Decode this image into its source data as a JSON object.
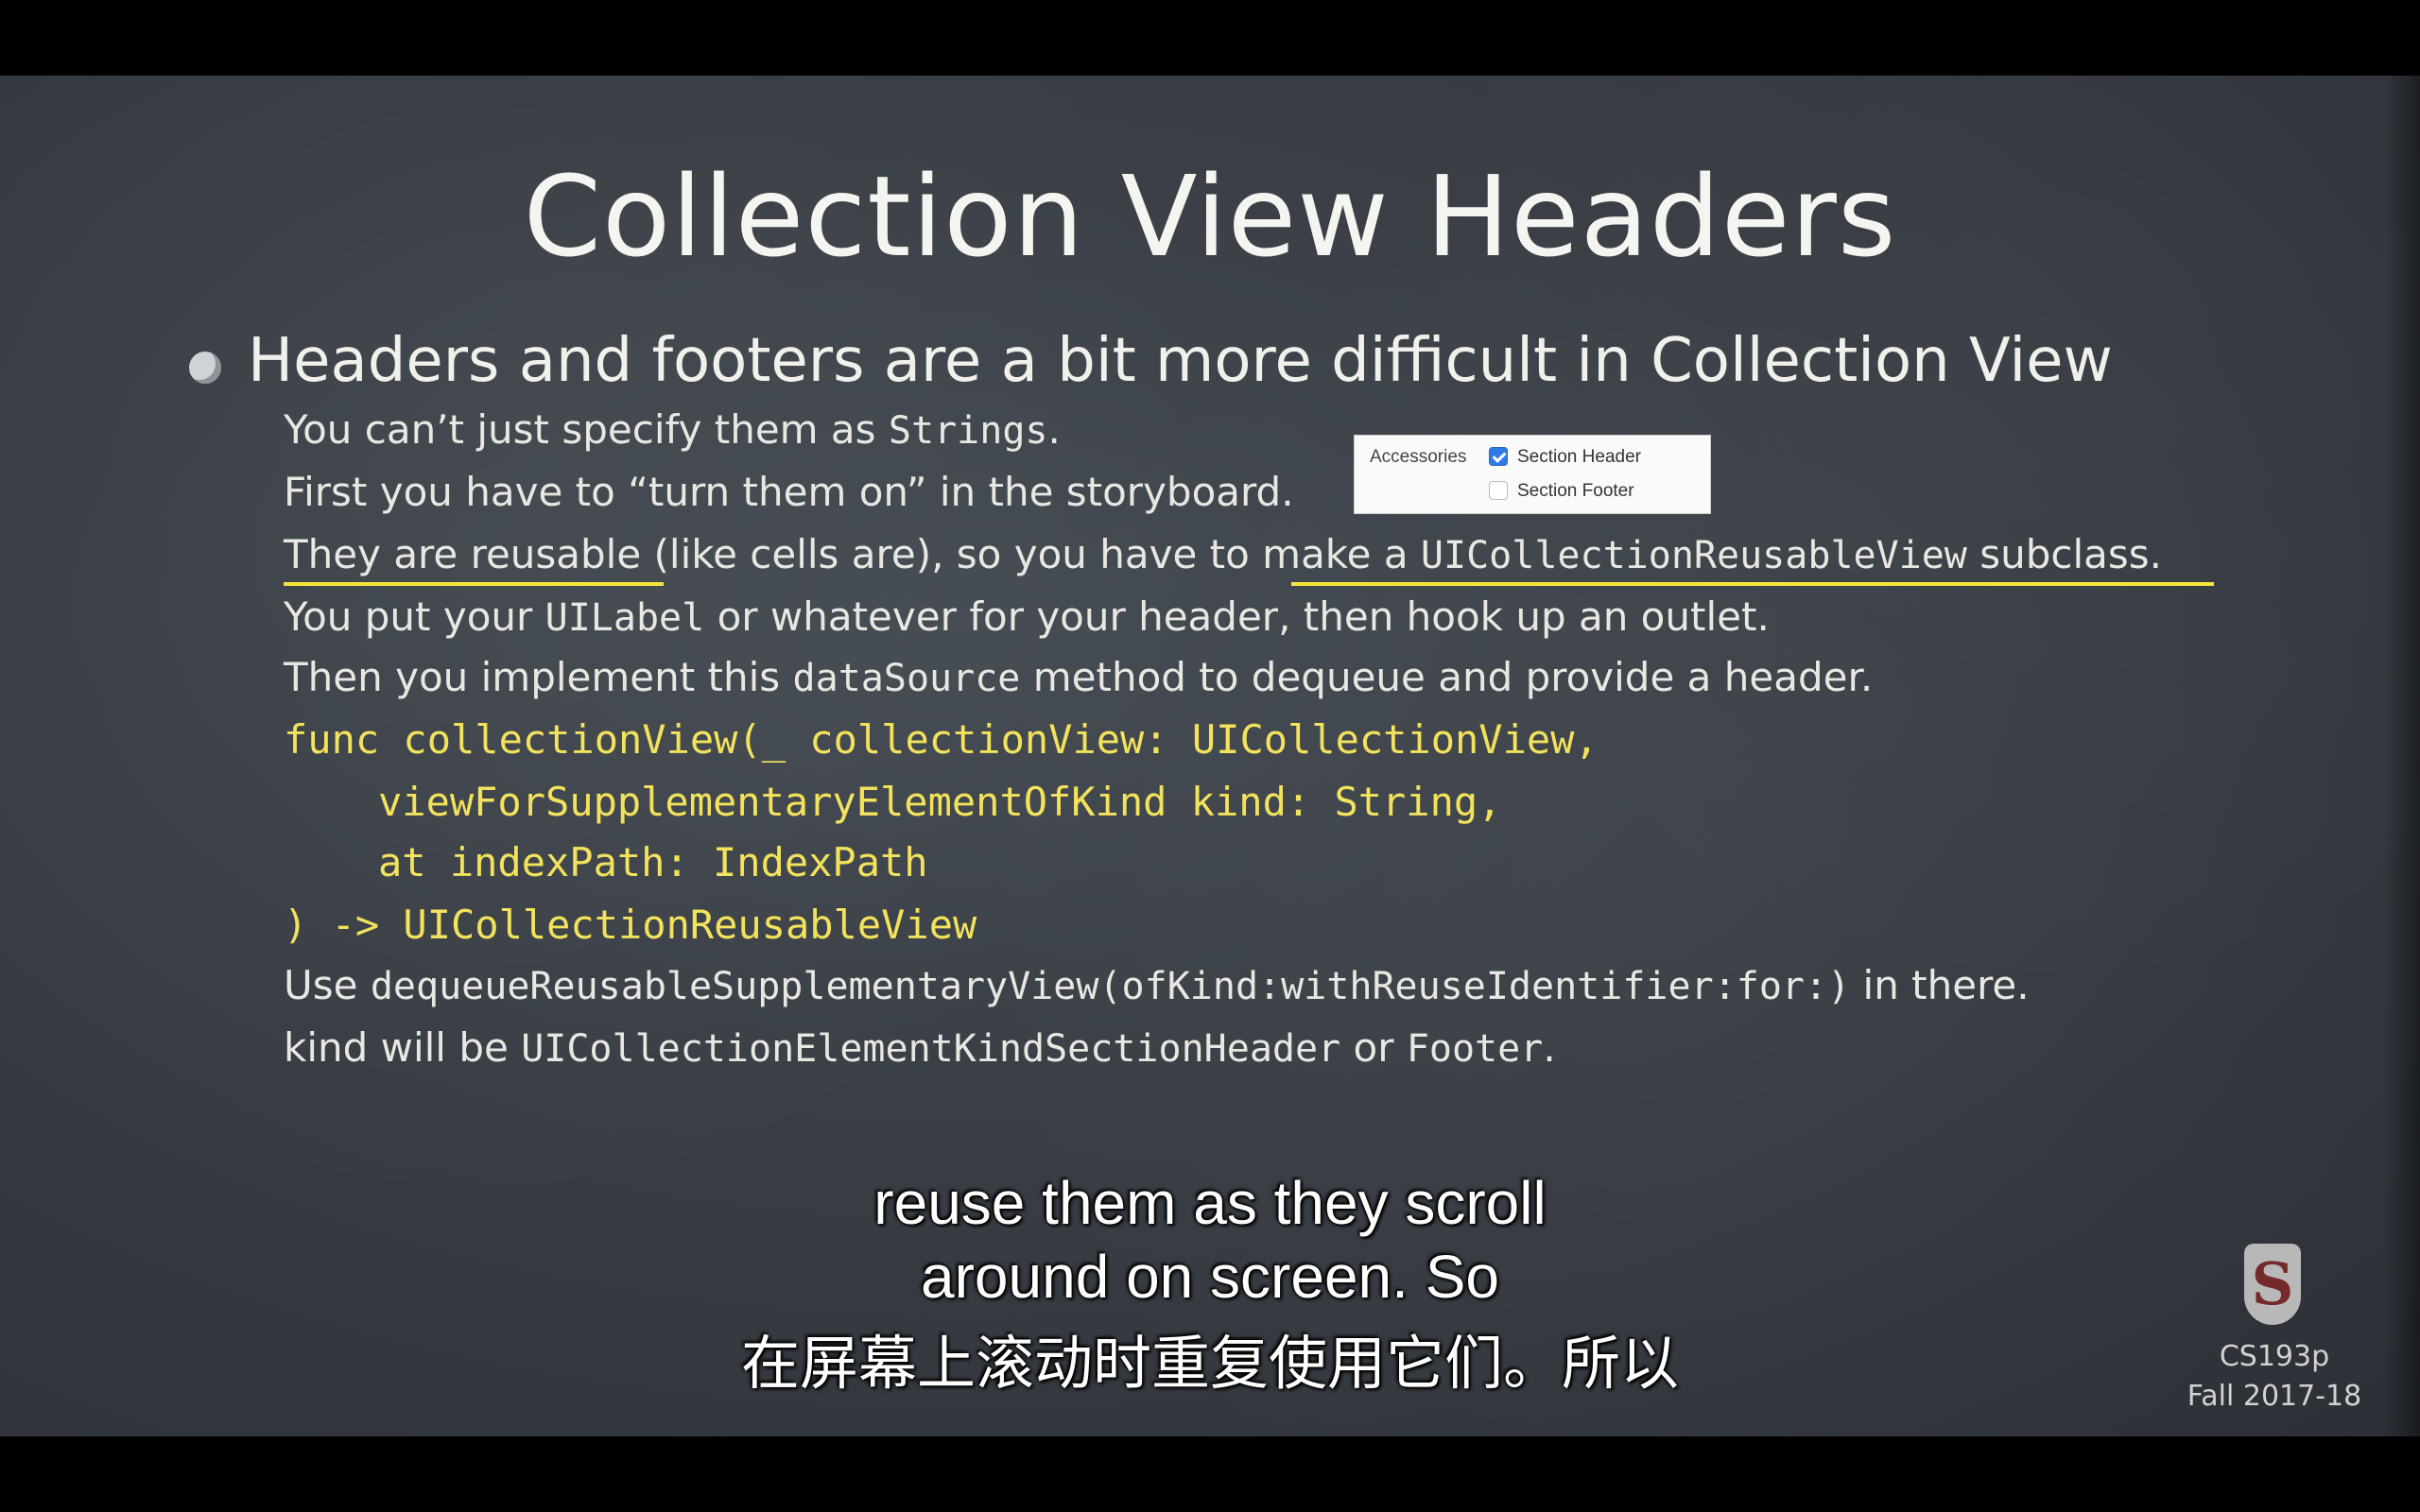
{
  "slide": {
    "title": "Collection View Headers",
    "bullet": "Headers and footers are a bit more difficult in Collection View",
    "lines": {
      "l1a": "You can’t just specify them as ",
      "l1b": "Strings",
      "l1c": ".",
      "l2": "First you have to “turn them on” in the storyboard.",
      "l3a": "They are reusable",
      "l3b": " (like cells are), so you have to ",
      "l3c": "make a ",
      "l3d": "UICollectionReusableView",
      "l3e": " subclass.",
      "l4a": "You put your ",
      "l4b": "UILabel",
      "l4c": " or whatever for your header, then hook up an outlet.",
      "l5a": "Then you implement this ",
      "l5b": "dataSource",
      "l5c": " method to dequeue and provide a header.",
      "code1": "func collectionView(_ collectionView: UICollectionView,",
      "code2": "viewForSupplementaryElementOfKind kind: String,",
      "code3": "at indexPath: IndexPath",
      "code4": ") -> UICollectionReusableView",
      "l6a": "Use ",
      "l6b": "dequeueReusableSupplementaryView(ofKind:withReuseIdentifier:for:)",
      "l6c": " in there.",
      "l7a": "kind will be ",
      "l7b": "UICollectionElementKindSectionHeader",
      "l7c": " or ",
      "l7d": "Footer",
      "l7e": "."
    },
    "accessories_panel": {
      "label": "Accessories",
      "section_header": "Section Header",
      "section_header_checked": true,
      "section_footer": "Section Footer",
      "section_footer_checked": false
    },
    "course": "CS193p",
    "term": "Fall 2017-18",
    "logo_letter": "S"
  },
  "subtitles": {
    "en1": "reuse them as they scroll",
    "en2": "around on screen. So",
    "zh": "在屏幕上滚动时重复使用它们。所以"
  },
  "colors": {
    "code_yellow": "#f2e25c",
    "underline": "#f5e63a",
    "board": "#393e45"
  }
}
